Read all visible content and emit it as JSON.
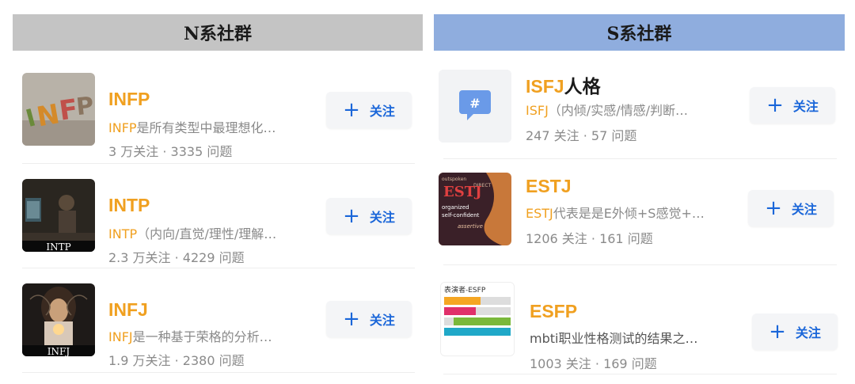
{
  "left": {
    "header": "N系社群",
    "items": [
      {
        "title": "INFP",
        "desc_hl": "INFP",
        "desc": "是所有类型中最理想化…",
        "stats": "3 万关注 · 3335 问题",
        "thumb_label": "INFP"
      },
      {
        "title": "INTP",
        "desc_hl": "INTP",
        "desc": "（内向/直觉/理性/理解…",
        "stats": "2.3 万关注 · 4229 问题",
        "thumb_label": "INTP"
      },
      {
        "title": "INFJ",
        "desc_hl": "INFJ",
        "desc": "是一种基于荣格的分析…",
        "stats": "1.9 万关注 · 2380 问题",
        "thumb_label": "INFJ"
      }
    ]
  },
  "right": {
    "header": "S系社群",
    "items": [
      {
        "title": "ISFJ",
        "title_suffix": "人格",
        "desc_hl": "ISFJ",
        "desc": "（内倾/实感/情感/判断…",
        "stats": "247 关注 · 57 问题"
      },
      {
        "title": "ESTJ",
        "desc_hl": "ESTJ",
        "desc": "代表是是E外倾+S感觉+…",
        "stats": "1206 关注 · 161 问题",
        "thumb_label": "ESTJ",
        "thumb_words": [
          "outspoken",
          "DIRECT",
          "organized",
          "self-confident",
          "assertive"
        ]
      },
      {
        "title": "ESFP",
        "desc_hl": "",
        "desc": "mbti职业性格测试的结果之…",
        "stats": "1003 关注 · 169 问题",
        "thumb_label": "表演者-ESFP"
      }
    ]
  },
  "follow_label": "关注",
  "follow_icon": "plus-icon",
  "colors": {
    "accent_orange": "#f0a020",
    "follow_blue": "#1a66d9",
    "header_left_bg": "#c4c4c4",
    "header_right_bg": "#8fadde"
  }
}
